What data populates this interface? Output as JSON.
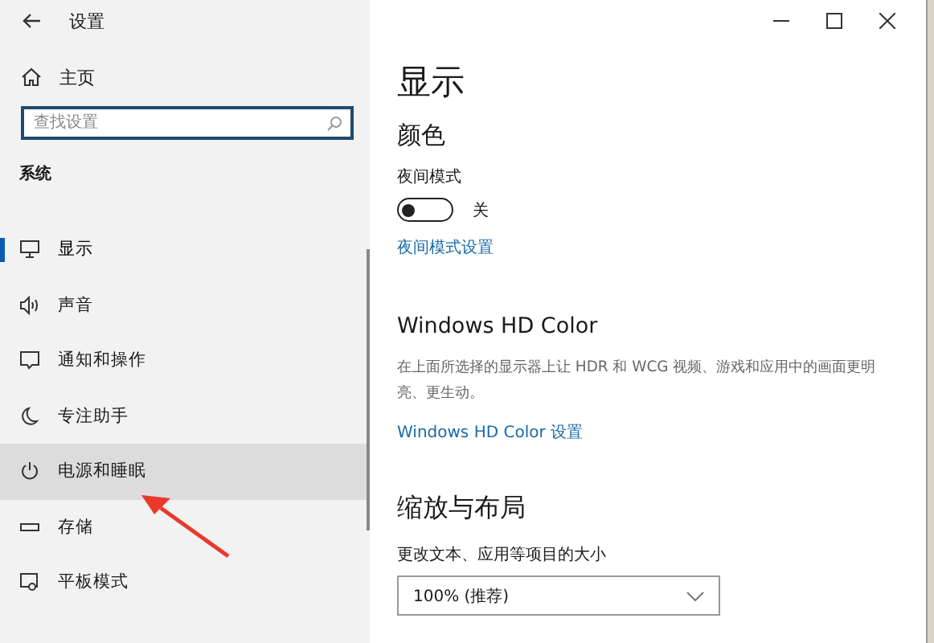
{
  "window": {
    "title": "设置"
  },
  "sidebar": {
    "home": "主页",
    "search": {
      "placeholder": "查找设置"
    },
    "section": "系统",
    "items": [
      {
        "label": "显示",
        "kind": "monitor",
        "selected": true,
        "hovered": false
      },
      {
        "label": "声音",
        "kind": "speaker",
        "selected": false,
        "hovered": false
      },
      {
        "label": "通知和操作",
        "kind": "message",
        "selected": false,
        "hovered": false
      },
      {
        "label": "专注助手",
        "kind": "moon",
        "selected": false,
        "hovered": false
      },
      {
        "label": "电源和睡眠",
        "kind": "power",
        "selected": false,
        "hovered": true
      },
      {
        "label": "存储",
        "kind": "drive",
        "selected": false,
        "hovered": false
      },
      {
        "label": "平板模式",
        "kind": "tablet",
        "selected": false,
        "hovered": false
      }
    ]
  },
  "content": {
    "title": "显示",
    "color_section": {
      "heading": "颜色",
      "night_label": "夜间模式",
      "night_on": false,
      "night_state": "关",
      "link": "夜间模式设置"
    },
    "hdr_section": {
      "heading": "Windows HD Color",
      "description": "在上面所选择的显示器上让 HDR 和 WCG 视频、游戏和应用中的画面更明亮、更生动。",
      "link": "Windows HD Color 设置"
    },
    "scale_section": {
      "heading": "缩放与布局",
      "label": "更改文本、应用等项目的大小",
      "dropdown": "100% (推荐)"
    }
  },
  "annotation": {
    "kind": "arrow"
  }
}
